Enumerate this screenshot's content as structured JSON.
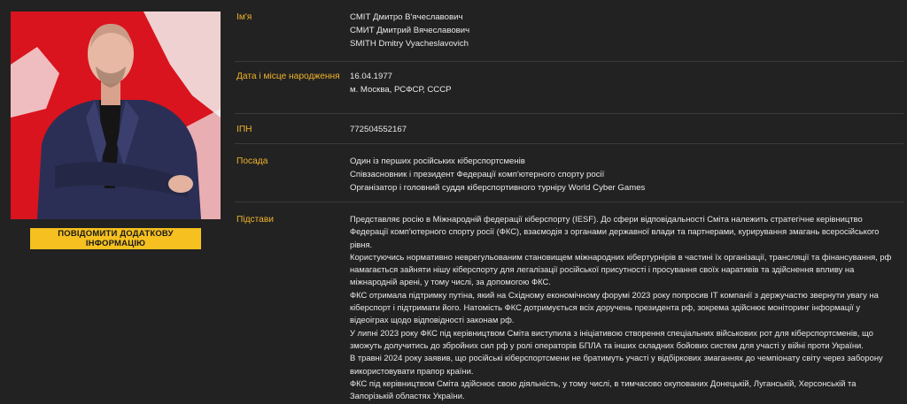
{
  "action": {
    "report_button": "ПОВІДОМИТИ ДОДАТКОВУ ІНФОРМАЦІЮ"
  },
  "profile": {
    "name": {
      "label": "Ім'я",
      "lines": [
        "СМІТ Дмитро В'ячеславович",
        "СМИТ Дмитрий Вячеславович",
        "SMITH Dmitry Vyacheslavovich"
      ]
    },
    "birth": {
      "label": "Дата і місце народження",
      "lines": [
        "16.04.1977",
        "м. Москва, РСФСР, СССР"
      ]
    },
    "inn": {
      "label": "ІПН",
      "value": "772504552167"
    },
    "position": {
      "label": "Посада",
      "lines": [
        "Один із перших російських кіберспортсменів",
        "Співзасновник і президент Федерації комп'ютерного спорту росії",
        "Організатор і головний суддя кіберспортивного турніру World Cyber Games"
      ]
    },
    "grounds": {
      "label": "Підстави",
      "paragraphs": [
        "Представляє росію в Міжнародній федерації кіберспорту (IESF). До сфери відповідальності Сміта належить стратегічне керівництво Федерації комп'ютерного спорту росії (ФКС), взаємодія з органами державної влади та партнерами, курирування змагань всеросійського рівня.",
        "Користуючись нормативно неврегульованим становищем міжнародних кібертурнірів в частині їх організації, трансляції та фінансування, рф намагається зайняти нішу кіберспорту для легалізації російської присутності і просування своїх наративів та здійснення впливу на міжнародній арені, у тому числі, за допомогою ФКС.",
        "ФКС отримала підтримку путіна, який на Східному економічному форумі 2023 року попросив ІТ компанії з держучастю звернути увагу на кіберспорт і підтримати його. Натомість ФКС дотримується всіх доручень президента рф, зокрема здійснює моніторинг інформації у відеоіграх щодо відповідності законам рф.",
        "У липні 2023 року ФКС під керівництвом Сміта виступила з ініціативою створення спеціальних військових рот для кіберспортсменів, що зможуть долучитись до збройних сил рф у ролі операторів БПЛА та інших складних бойових систем для участі у війні проти України.",
        "В травні 2024 року заявив, що російські кіберспортсмени не братимуть участі у відбіркових змаганнях до чемпіонату світу через заборону використовувати прапор країни.",
        "ФКС під керівництвом Сміта здійснює свою діяльність, у тому числі, в тимчасово окупованих Донецькій, Луганській, Херсонській та Запорізькій областях України."
      ]
    }
  },
  "colors": {
    "background": "#222222",
    "label": "#f0b429",
    "button": "#f5c020",
    "photo_backdrop": "#d9141e"
  }
}
